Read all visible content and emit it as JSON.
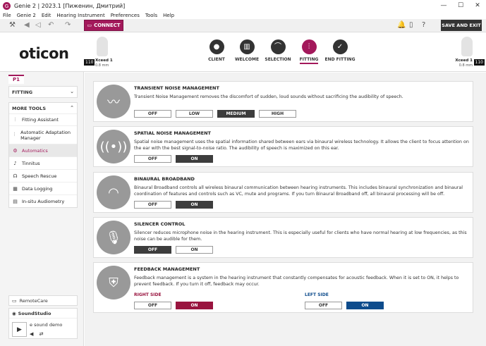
{
  "window": {
    "title": "Genie 2 | 2023.1 [Пиженин, Дмитрий]",
    "app_icon": "genie-logo",
    "controls": [
      "—",
      "☐",
      "✕"
    ]
  },
  "menu": [
    "File",
    "Genie 2",
    "Edit",
    "Hearing Instrument",
    "Preferences",
    "Tools",
    "Help"
  ],
  "toolbar": {
    "connect_label": "CONNECT",
    "save_label": "SAVE AND EXIT"
  },
  "brand": "oticon",
  "hearing_left": {
    "number": "110",
    "name": "Xceed 1",
    "sub": "0.8 mm"
  },
  "hearing_right": {
    "number": "110",
    "name": "Xceed 1",
    "sub": "0.8 mm"
  },
  "steps": [
    {
      "label": "CLIENT",
      "icon": "person-icon"
    },
    {
      "label": "WELCOME",
      "icon": "welcome-icon"
    },
    {
      "label": "SELECTION",
      "icon": "selection-icon"
    },
    {
      "label": "FITTING",
      "icon": "sliders-icon",
      "active": true
    },
    {
      "label": "END FITTING",
      "icon": "check-icon"
    }
  ],
  "sidebar": {
    "tab": "P1",
    "fitting_label": "FITTING",
    "more_tools_label": "MORE TOOLS",
    "items": [
      {
        "label": "Fitting Assistant",
        "icon": "fitting-assistant-icon"
      },
      {
        "label": "Automatic Adaptation Manager",
        "icon": "adaptation-icon"
      },
      {
        "label": "Automatics",
        "icon": "gear-icon",
        "active": true
      },
      {
        "label": "Tinnitus",
        "icon": "tinnitus-icon"
      },
      {
        "label": "Speech Rescue",
        "icon": "speech-icon"
      },
      {
        "label": "Data Logging",
        "icon": "chart-icon"
      },
      {
        "label": "In-situ Audiometry",
        "icon": "audiometry-icon"
      }
    ],
    "remote_label": "RemoteCare",
    "sound_label": "SoundStudio",
    "demo_label": "e sound demo"
  },
  "panels": [
    {
      "title": "TRANSIENT NOISE MANAGEMENT",
      "desc": "Transient Noise Management removes the discomfort of sudden, loud sounds without sacrificing the audibility of speech.",
      "buttons": [
        "OFF",
        "LOW",
        "MEDIUM",
        "HIGH"
      ],
      "selected": "MEDIUM"
    },
    {
      "title": "SPATIAL NOISE MANAGEMENT",
      "desc": "Spatial noise management uses the spatial information shared between ears via binaural wireless technology. It allows the client to focus attention on the ear with the best signal-to-noise ratio. The audibility of speech is maximized on this ear.",
      "buttons": [
        "OFF",
        "ON"
      ],
      "selected": "ON"
    },
    {
      "title": "BINAURAL BROADBAND",
      "desc": "Binaural Broadband controls all wireless binaural communication between hearing instruments. This includes binaural synchronization and binaural coordination of features and controls such as VC, mute and programs. If you turn Binaural Broadband off, all binaural processing will be off.",
      "buttons": [
        "OFF",
        "ON"
      ],
      "selected": "ON"
    },
    {
      "title": "SILENCER CONTROL",
      "desc": "Silencer reduces microphone noise in the hearing instrument. This is especially useful for clients who have normal hearing at low frequencies, as this noise can be audible for them.",
      "buttons": [
        "OFF",
        "ON"
      ],
      "selected": "OFF"
    },
    {
      "title": "FEEDBACK MANAGEMENT",
      "desc": "Feedback management is a system in the hearing instrument that constantly compensates for acoustic feedback. When it is set to ON, it helps to prevent feedback. If you turn it off, feedback may occur.",
      "right_label": "RIGHT SIDE",
      "left_label": "LEFT SIDE",
      "buttons": [
        "OFF",
        "ON"
      ],
      "right_selected": "ON",
      "left_selected": "ON"
    }
  ],
  "colors": {
    "accent": "#a3195b",
    "right": "#99143f",
    "left": "#0e4c8c",
    "dark": "#3d3d3d"
  }
}
